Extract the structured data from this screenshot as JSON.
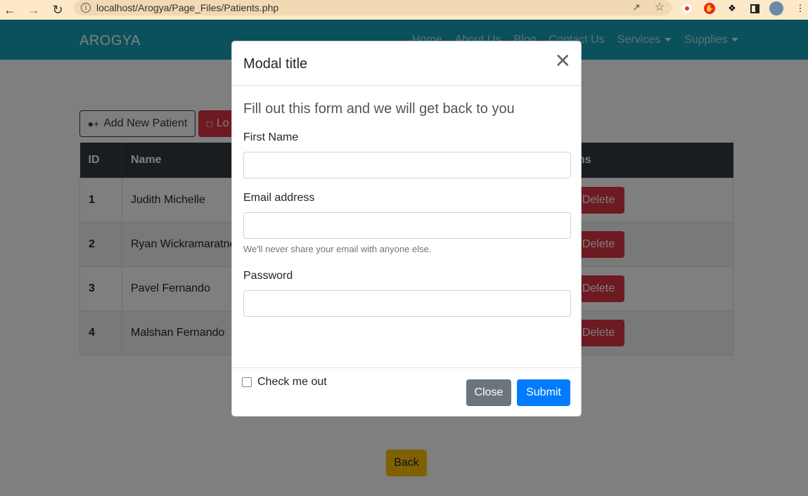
{
  "browser": {
    "url": "localhost/Arogya/Page_Files/Patients.php"
  },
  "navbar": {
    "brand": "AROGYA",
    "links": [
      "Home",
      "About Us",
      "Blog",
      "Contact Us"
    ],
    "dropdowns": [
      "Services",
      "Supplies"
    ]
  },
  "toolbar": {
    "add_label": "Add New Patient",
    "red_label": "Lo"
  },
  "table": {
    "headers": [
      "ID",
      "Name",
      "ns"
    ],
    "rows": [
      {
        "id": "1",
        "name": "Judith Michelle",
        "delete": "Delete"
      },
      {
        "id": "2",
        "name": "Ryan Wickramaratne",
        "delete": "Delete"
      },
      {
        "id": "3",
        "name": "Pavel Fernando",
        "delete": "Delete"
      },
      {
        "id": "4",
        "name": "Malshan Fernando",
        "delete": "Delete"
      }
    ]
  },
  "back_label": "Back",
  "modal": {
    "title": "Modal title",
    "lead": "Fill out this form and we will get back to you",
    "first_name_label": "First Name",
    "email_label": "Email address",
    "email_help": "We'll never share your email with anyone else.",
    "password_label": "Password",
    "check_label": "Check me out",
    "close_label": "Close",
    "submit_label": "Submit"
  }
}
